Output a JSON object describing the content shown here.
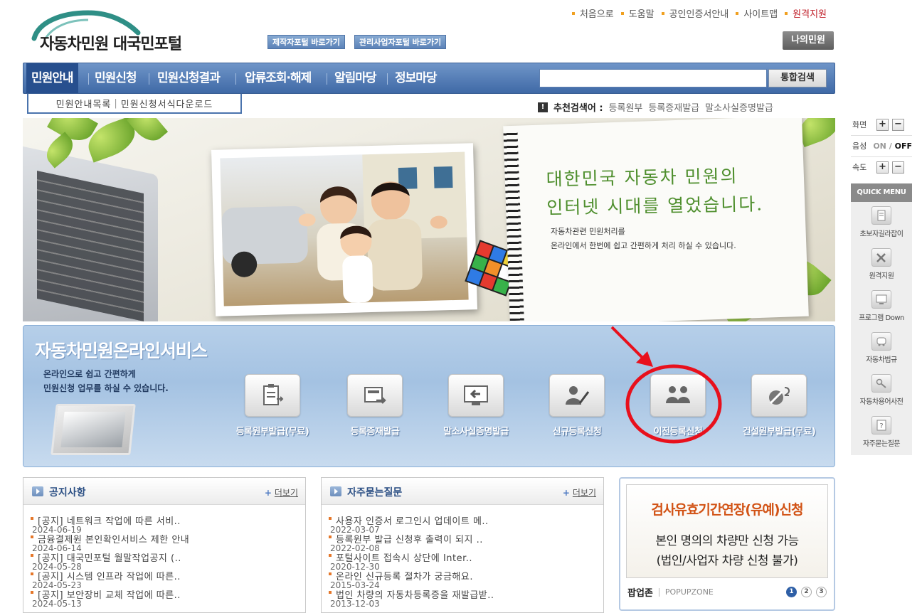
{
  "header": {
    "logo_text": "자동차민원 대국민포털",
    "portal_buttons": [
      "제작자포털 바로가기",
      "관리사업자포털 바로가기"
    ],
    "top_links": [
      "처음으로",
      "도움말",
      "공인인증서안내",
      "사이트맵",
      "원격지원"
    ],
    "my_button": "나의민원"
  },
  "nav": {
    "items": [
      "민원안내",
      "민원신청",
      "민원신청결과",
      "압류조회·해제",
      "알림마당",
      "정보마당"
    ],
    "search_button": "통합검색",
    "search_value": ""
  },
  "subnav": {
    "items": [
      "민원안내목록",
      "민원신청서식다운로드"
    ]
  },
  "recommend": {
    "icon": "!",
    "label": "추천검색어 :",
    "terms": [
      "등록원부",
      "등록증재발급",
      "말소사실증명발급"
    ]
  },
  "hero": {
    "headline_1": "대한민국 자동차 민원의",
    "headline_2": "인터넷 시대를 열었습니다.",
    "sub_1": "자동차관련 민원처리를",
    "sub_2": "온라인에서 한번에 쉽고 간편하게 처리 하실 수 있습니다."
  },
  "services": {
    "title": "자동차민원온라인서비스",
    "desc_1": "온라인으로 쉽고 간편하게",
    "desc_2": "민원신청 업무를 하실 수 있습니다.",
    "items": [
      {
        "label": "등록원부발급(무료)",
        "icon": "document-clipboard-icon"
      },
      {
        "label": "등록증재발급",
        "icon": "card-reissue-icon"
      },
      {
        "label": "말소사실증명발급",
        "icon": "monitor-arrow-icon"
      },
      {
        "label": "신규등록신청",
        "icon": "person-pen-icon"
      },
      {
        "label": "이전등록신청",
        "icon": "two-persons-icon"
      },
      {
        "label": "건설원부발급(무료)",
        "icon": "wrench-icon"
      }
    ],
    "annotation_color": "#e8101c"
  },
  "notice": {
    "title": "공지사항",
    "more": "더보기",
    "items": [
      {
        "title": "[공지] 네트워크 작업에 따른 서비..",
        "date": "2024-06-19"
      },
      {
        "title": "금융결제원 본인확인서비스 제한 안내",
        "date": "2024-06-14"
      },
      {
        "title": "[공지] 대국민포털 월말작업공지 (..",
        "date": "2024-05-28"
      },
      {
        "title": "[공지] 시스템 인프라 작업에 따른..",
        "date": "2024-05-23"
      },
      {
        "title": "[공지] 보안장비 교체 작업에 따른..",
        "date": "2024-05-13"
      }
    ]
  },
  "faq": {
    "title": "자주묻는질문",
    "more": "더보기",
    "items": [
      {
        "title": "사용자 인증서 로그인시 업데이트 메..",
        "date": "2022-03-07"
      },
      {
        "title": "등록원부 발급 신청후 출력이 되지 ..",
        "date": "2022-02-08"
      },
      {
        "title": "포털사이트 접속시 상단에 Inter..",
        "date": "2020-12-30"
      },
      {
        "title": "온라인 신규등록 절차가 궁금해요.",
        "date": "2015-03-24"
      },
      {
        "title": "법인 차량의 자동차등록증을 재발급받..",
        "date": "2013-12-03"
      }
    ]
  },
  "popup": {
    "title": "검사유효기간연장(유예)신청",
    "line_1": "본인 명의의 차량만 신청 가능",
    "line_2": "(법인/사업자 차량 신청 불가)",
    "zone_label": "팝업존",
    "zone_eng": "POPUPZONE",
    "pages": [
      "1",
      "2",
      "3"
    ]
  },
  "side": {
    "screen_label": "화면",
    "voice_label": "음성",
    "voice_on": "ON",
    "voice_sep": "/",
    "voice_off": "OFF",
    "speed_label": "속도",
    "plus": "+",
    "minus": "−",
    "quick_menu": "QUICK MENU",
    "quick_items": [
      "초보자길라잡이",
      "원격지원",
      "프로그램 Down",
      "자동차법규",
      "자동차용어사전",
      "자주묻는질문"
    ]
  }
}
